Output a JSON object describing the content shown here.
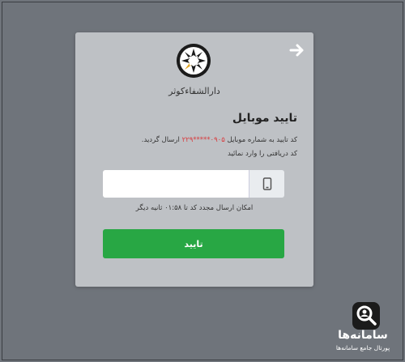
{
  "brand": {
    "name": "دارالشفاءکوثر"
  },
  "page": {
    "title": "تایید موبایل",
    "desc_prefix": "کد تایید به شماره موبایل",
    "phone": "۰۹۰۵*****۲۲۹",
    "desc_suffix": "ارسال گردید.",
    "desc_line2": "کد دریافتی را وارد نمائید"
  },
  "form": {
    "code_value": "",
    "code_placeholder": "",
    "timer_text": "امکان ارسال مجدد کد تا ۰۱:۵۸ ثانیه دیگر",
    "confirm_label": "تایید"
  },
  "watermark": {
    "title": "سامانه‌ها",
    "subtitle": "پورتال جامع سامانه‌ها"
  },
  "colors": {
    "background": "#6f747b",
    "card": "#bec1c5",
    "accent_green": "#28a744",
    "phone_red": "#d9393b"
  },
  "icons": [
    "back-arrow-icon",
    "logo-emblem-icon",
    "mobile-phone-icon",
    "watermark-search-icon"
  ]
}
